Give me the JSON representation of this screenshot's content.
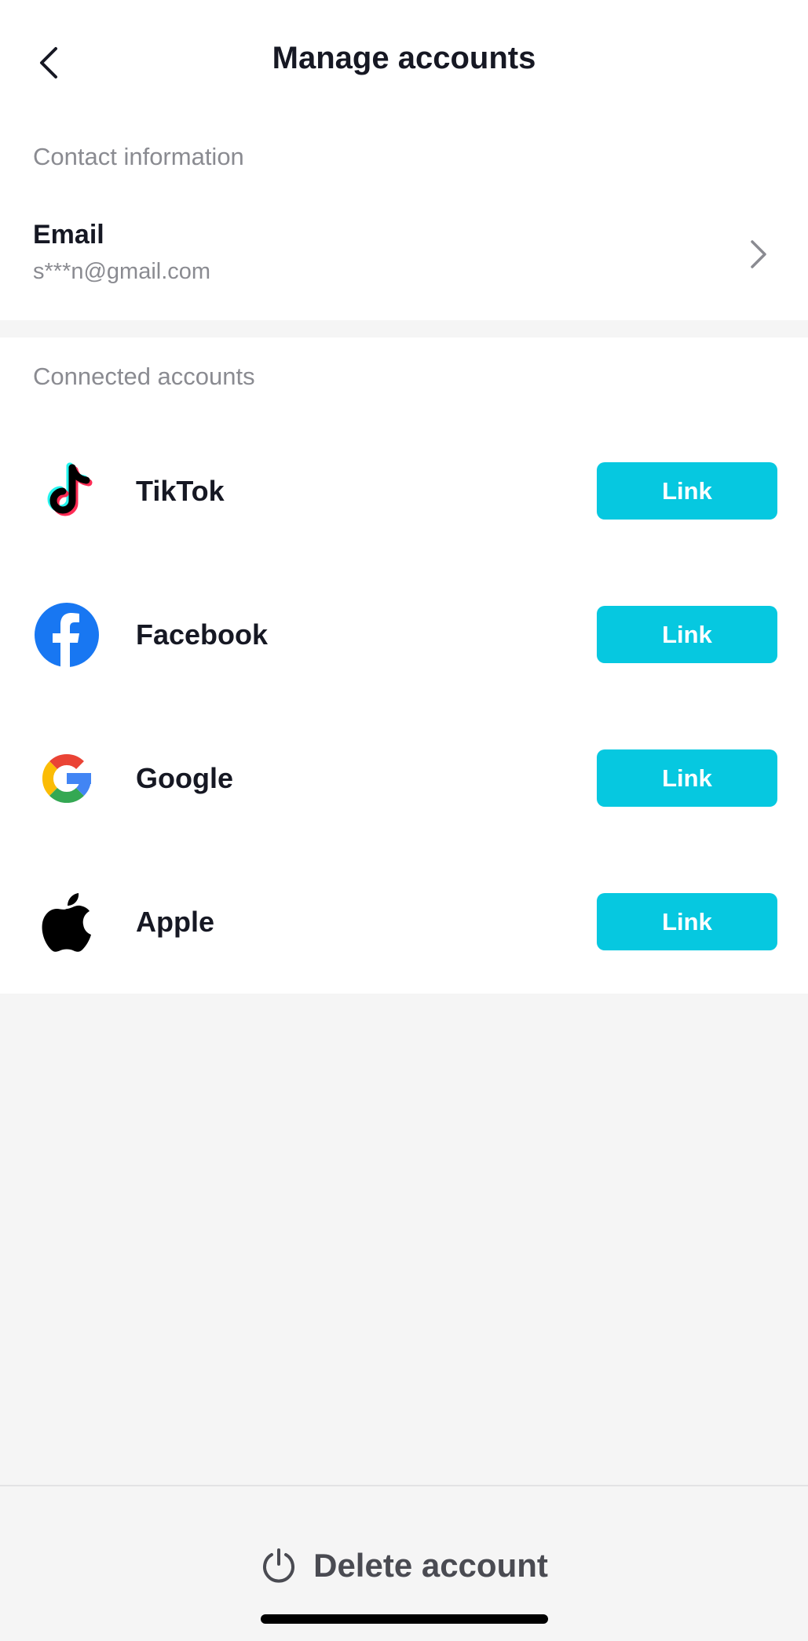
{
  "header": {
    "back_icon": "chevron-left-icon",
    "title": "Manage accounts"
  },
  "contact": {
    "section_label": "Contact information",
    "email_title": "Email",
    "email_value": "s***n@gmail.com",
    "chevron_icon": "chevron-right-icon"
  },
  "connected": {
    "section_label": "Connected accounts",
    "accounts": [
      {
        "name": "TikTok",
        "icon": "tiktok-icon",
        "button": "Link"
      },
      {
        "name": "Facebook",
        "icon": "facebook-icon",
        "button": "Link"
      },
      {
        "name": "Google",
        "icon": "google-icon",
        "button": "Link"
      },
      {
        "name": "Apple",
        "icon": "apple-icon",
        "button": "Link"
      }
    ]
  },
  "footer": {
    "delete_label": "Delete account",
    "delete_icon": "power-icon"
  },
  "colors": {
    "accent": "#06c8e0",
    "text_primary": "#161823",
    "text_secondary": "#8a8b91",
    "background": "#f5f5f5"
  }
}
